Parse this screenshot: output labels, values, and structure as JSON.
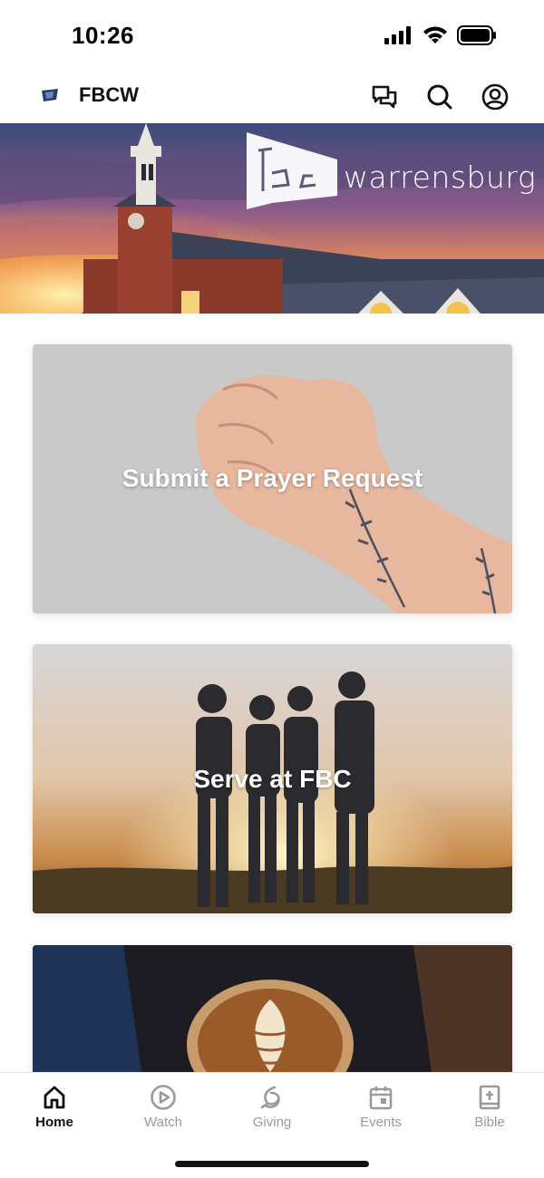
{
  "status_bar": {
    "time": "10:26",
    "icons": [
      "cellular-signal-icon",
      "wifi-icon",
      "battery-icon"
    ]
  },
  "header": {
    "app_name": "FBCW",
    "icons": [
      "chat-icon",
      "search-icon",
      "profile-icon"
    ]
  },
  "hero": {
    "brand_text": "warrensburg",
    "logo_text": "fbc"
  },
  "cards": [
    {
      "title": "Submit a Prayer Request"
    },
    {
      "title": "Serve at FBC"
    },
    {
      "title": ""
    }
  ],
  "tabs": [
    {
      "label": "Home",
      "icon": "home-icon",
      "active": true
    },
    {
      "label": "Watch",
      "icon": "play-icon",
      "active": false
    },
    {
      "label": "Giving",
      "icon": "giving-icon",
      "active": false
    },
    {
      "label": "Events",
      "icon": "calendar-icon",
      "active": false
    },
    {
      "label": "Bible",
      "icon": "bible-icon",
      "active": false
    }
  ],
  "colors": {
    "accent": "#111111",
    "inactive_tab": "#9a9a9a",
    "hero_sky_top": "#3d4a7a",
    "hero_sunset": "#f2a24a"
  }
}
